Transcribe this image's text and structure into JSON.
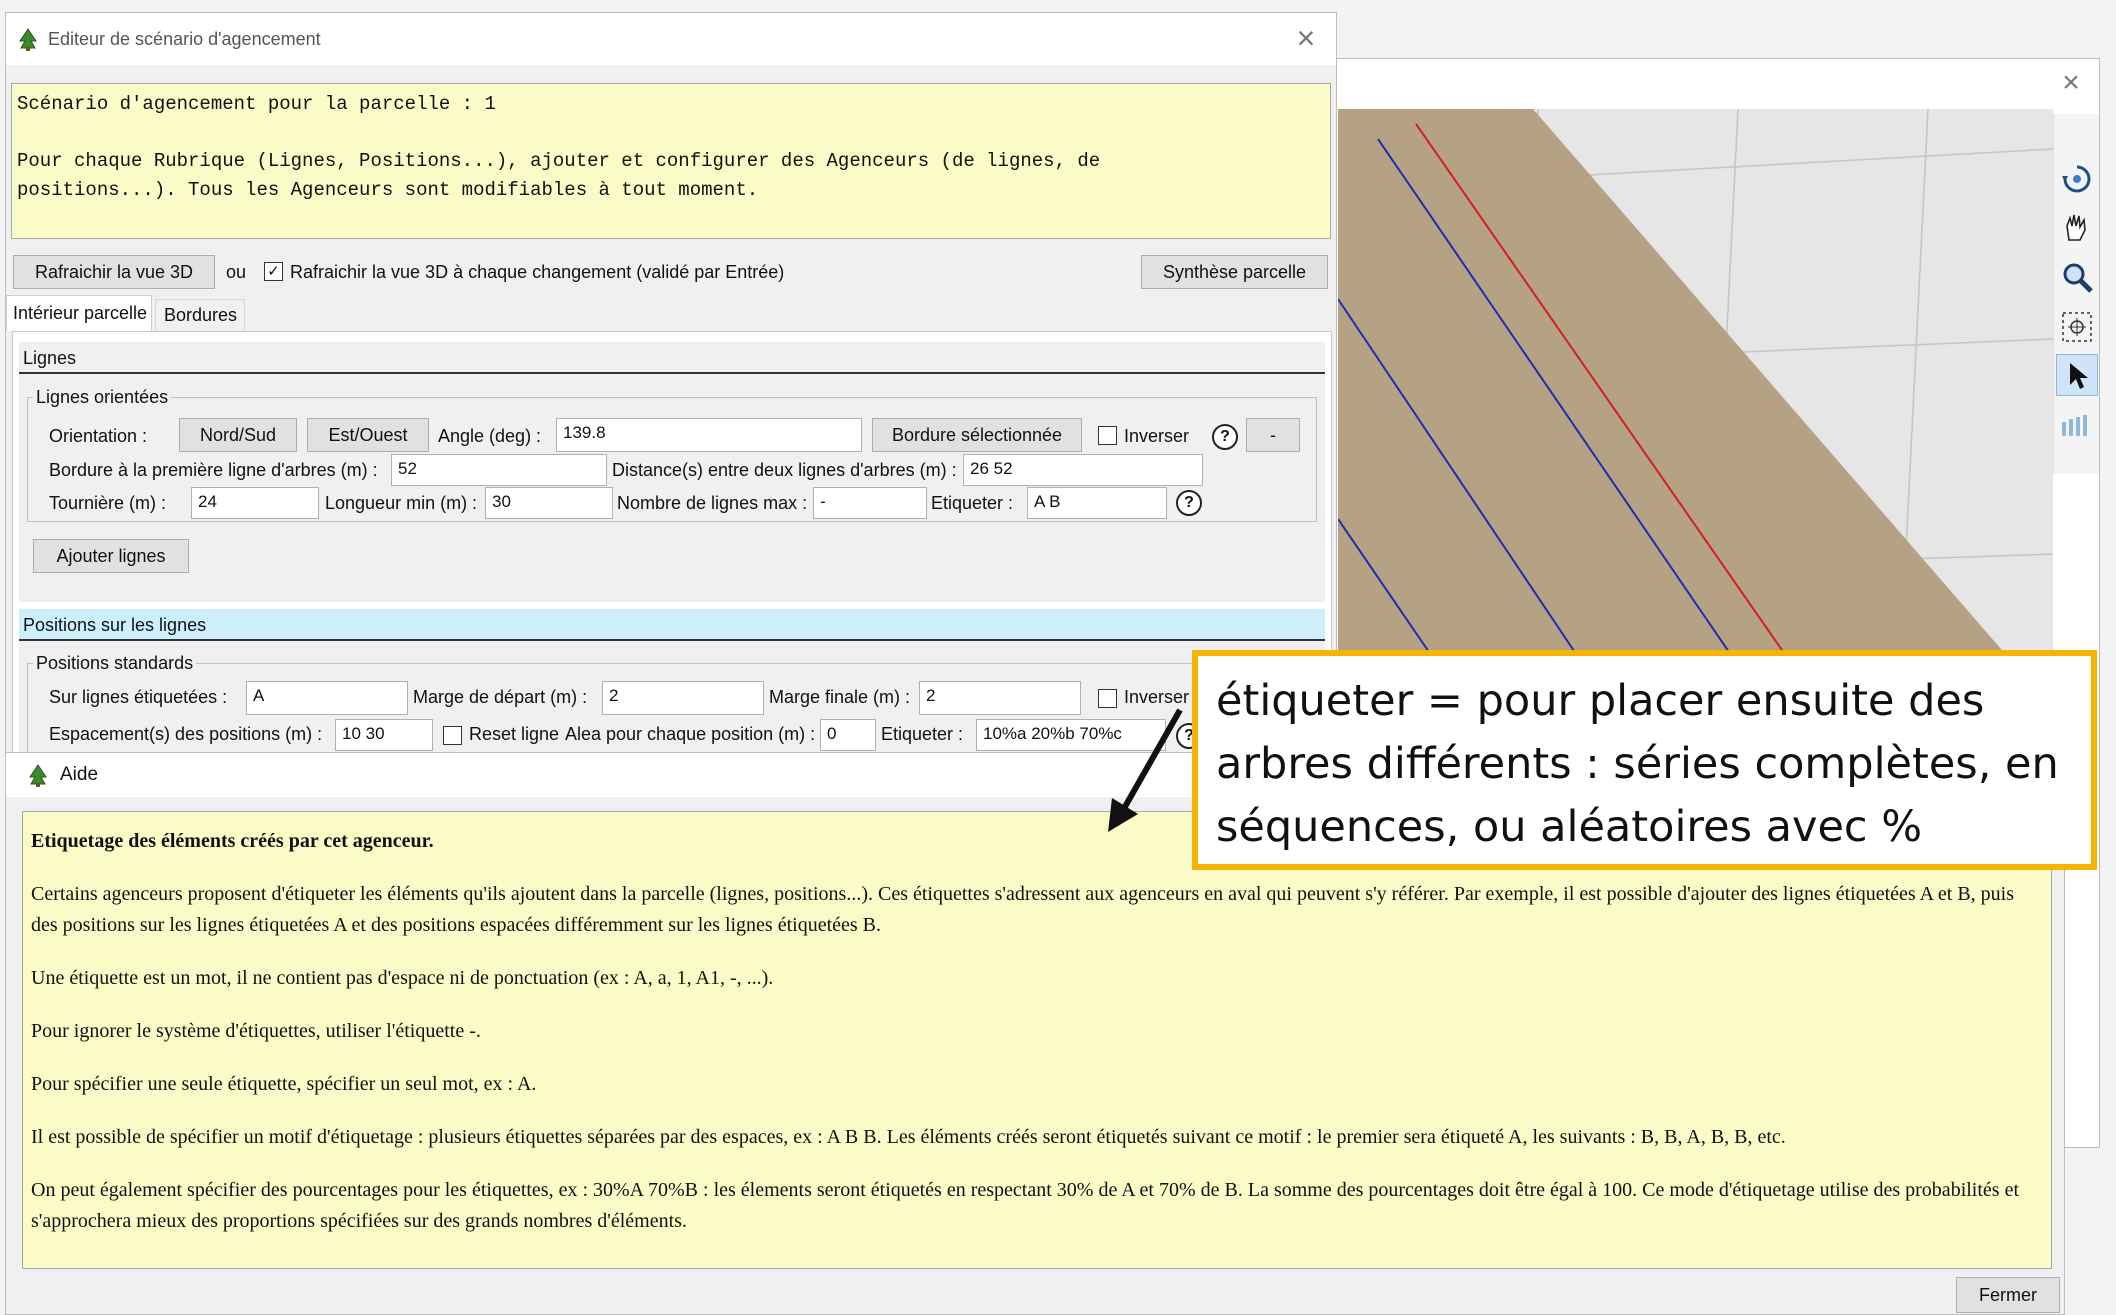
{
  "editor": {
    "title": "Editeur de scénario d'agencement",
    "close": "×",
    "info_line1": "Scénario d'agencement pour la parcelle : 1",
    "info_line2": "Pour chaque Rubrique (Lignes, Positions...), ajouter et configurer des Agenceurs (de lignes, de",
    "info_line3": "positions...). Tous les Agenceurs sont modifiables à tout moment.",
    "refresh_btn": "Rafraichir la vue 3D",
    "or_text": "ou",
    "auto_refresh_label": "Rafraichir la vue 3D à chaque changement (validé par Entrée)",
    "auto_refresh_checked": true,
    "synthese_btn": "Synthèse parcelle",
    "tabs": [
      "Intérieur parcelle",
      "Bordures"
    ]
  },
  "lignes": {
    "header": "Lignes",
    "group": "Lignes orientées",
    "orientation_label": "Orientation :",
    "nord_sud_btn": "Nord/Sud",
    "est_ouest_btn": "Est/Ouest",
    "angle_label": "Angle (deg) :",
    "angle_value": "139.8",
    "bordure_btn": "Bordure sélectionnée",
    "inverser_label": "Inverser",
    "inverser_checked": false,
    "help": "?",
    "minus_btn": "-",
    "bordure_label": "Bordure à la première ligne d'arbres (m) :",
    "bordure_value": "52",
    "distance_label": "Distance(s) entre deux lignes d'arbres (m) :",
    "distance_value": "26 52",
    "tourniere_label": "Tournière (m) :",
    "tourniere_value": "24",
    "longueur_label": "Longueur min (m) :",
    "longueur_value": "30",
    "nombre_label": "Nombre de lignes max :",
    "nombre_value": "-",
    "etiqueter_label": "Etiqueter :",
    "etiqueter_value": "A B",
    "ajouter_btn": "Ajouter lignes"
  },
  "positions": {
    "header": "Positions sur les lignes",
    "group": "Positions standards",
    "sur_label": "Sur lignes étiquetées :",
    "sur_value": "A",
    "marge_dep_label": "Marge de départ (m) :",
    "marge_dep_value": "2",
    "marge_fin_label": "Marge finale (m) :",
    "marge_fin_value": "2",
    "inverser_label": "Inverser",
    "espacement_label": "Espacement(s) des positions (m) :",
    "espacement_value": "10 30",
    "reset_label": "Reset ligne",
    "alea_label": "Alea pour chaque position (m) :",
    "alea_value": "0",
    "etiqueter_label": "Etiqueter :",
    "etiqueter_value": "10%a 20%b 70%c"
  },
  "aide": {
    "title": "Aide",
    "heading": "Etiquetage des éléments créés par cet agenceur.",
    "paragraphs": [
      "Certains agenceurs proposent d'étiqueter les éléments qu'ils ajoutent dans la parcelle (lignes, positions...). Ces étiquettes s'adressent aux agenceurs en aval qui peuvent s'y référer. Par exemple, il est possible d'ajouter des lignes étiquetées A et B, puis des positions sur les lignes étiquetées A et des positions espacées différemment sur les lignes étiquetées B.",
      "Une étiquette est un mot, il ne contient pas d'espace ni de ponctuation (ex : A, a, 1, A1, -, ...).",
      "Pour ignorer le système d'étiquettes, utiliser l'étiquette -.",
      "Pour spécifier une seule étiquette, spécifier un seul mot, ex : A.",
      "Il est possible de spécifier un motif d'étiquetage : plusieurs étiquettes séparées par des espaces, ex : A B B. Les éléments créés seront étiquetés suivant ce motif : le premier sera étiqueté A, les suivants : B, B, A, B, B, etc.",
      "On peut également spécifier des pourcentages pour les étiquettes, ex : 30%A 70%B : les élements seront étiquetés en respectant 30% de A et 70% de B. La somme des pourcentages doit être égal à 100. Ce mode d'étiquetage utilise des probabilités et s'approchera mieux des proportions spécifiées sur des grands nombres d'éléments."
    ],
    "close_btn": "Fermer"
  },
  "callout": {
    "text": "étiqueter = pour placer ensuite des arbres différents : séries complètes, en séquences, ou aléatoires avec %",
    "border_color": "#f5b400"
  },
  "view3d": {
    "close": "×",
    "ground_color": "#b5a285",
    "red_line_color": "#d02020",
    "blue_line_color": "#1f2fa8",
    "tools": [
      "rotate-icon",
      "pan-hand-icon",
      "zoom-icon",
      "center-target-icon",
      "select-pointer-icon",
      "scale-bars-icon"
    ]
  }
}
